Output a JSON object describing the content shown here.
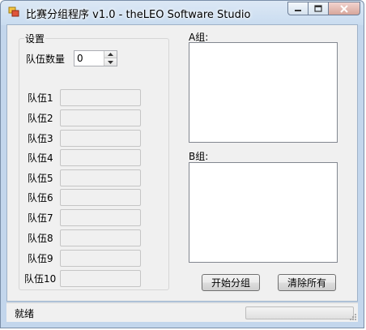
{
  "window": {
    "title": "比赛分组程序 v1.0  -  theLEO Software Studio",
    "icon": "app-icon"
  },
  "settings": {
    "title": "设置",
    "team_count_label": "队伍数量",
    "team_count_value": "0",
    "teams": [
      {
        "label": "队伍1",
        "value": ""
      },
      {
        "label": "队伍2",
        "value": ""
      },
      {
        "label": "队伍3",
        "value": ""
      },
      {
        "label": "队伍4",
        "value": ""
      },
      {
        "label": "队伍5",
        "value": ""
      },
      {
        "label": "队伍6",
        "value": ""
      },
      {
        "label": "队伍7",
        "value": ""
      },
      {
        "label": "队伍8",
        "value": ""
      },
      {
        "label": "队伍9",
        "value": ""
      },
      {
        "label": "队伍10",
        "value": ""
      }
    ]
  },
  "groups": {
    "a_label": "A组:",
    "b_label": "B组:"
  },
  "buttons": {
    "start": "开始分组",
    "clear": "清除所有"
  },
  "status": {
    "text": "就绪",
    "progress": 0
  }
}
